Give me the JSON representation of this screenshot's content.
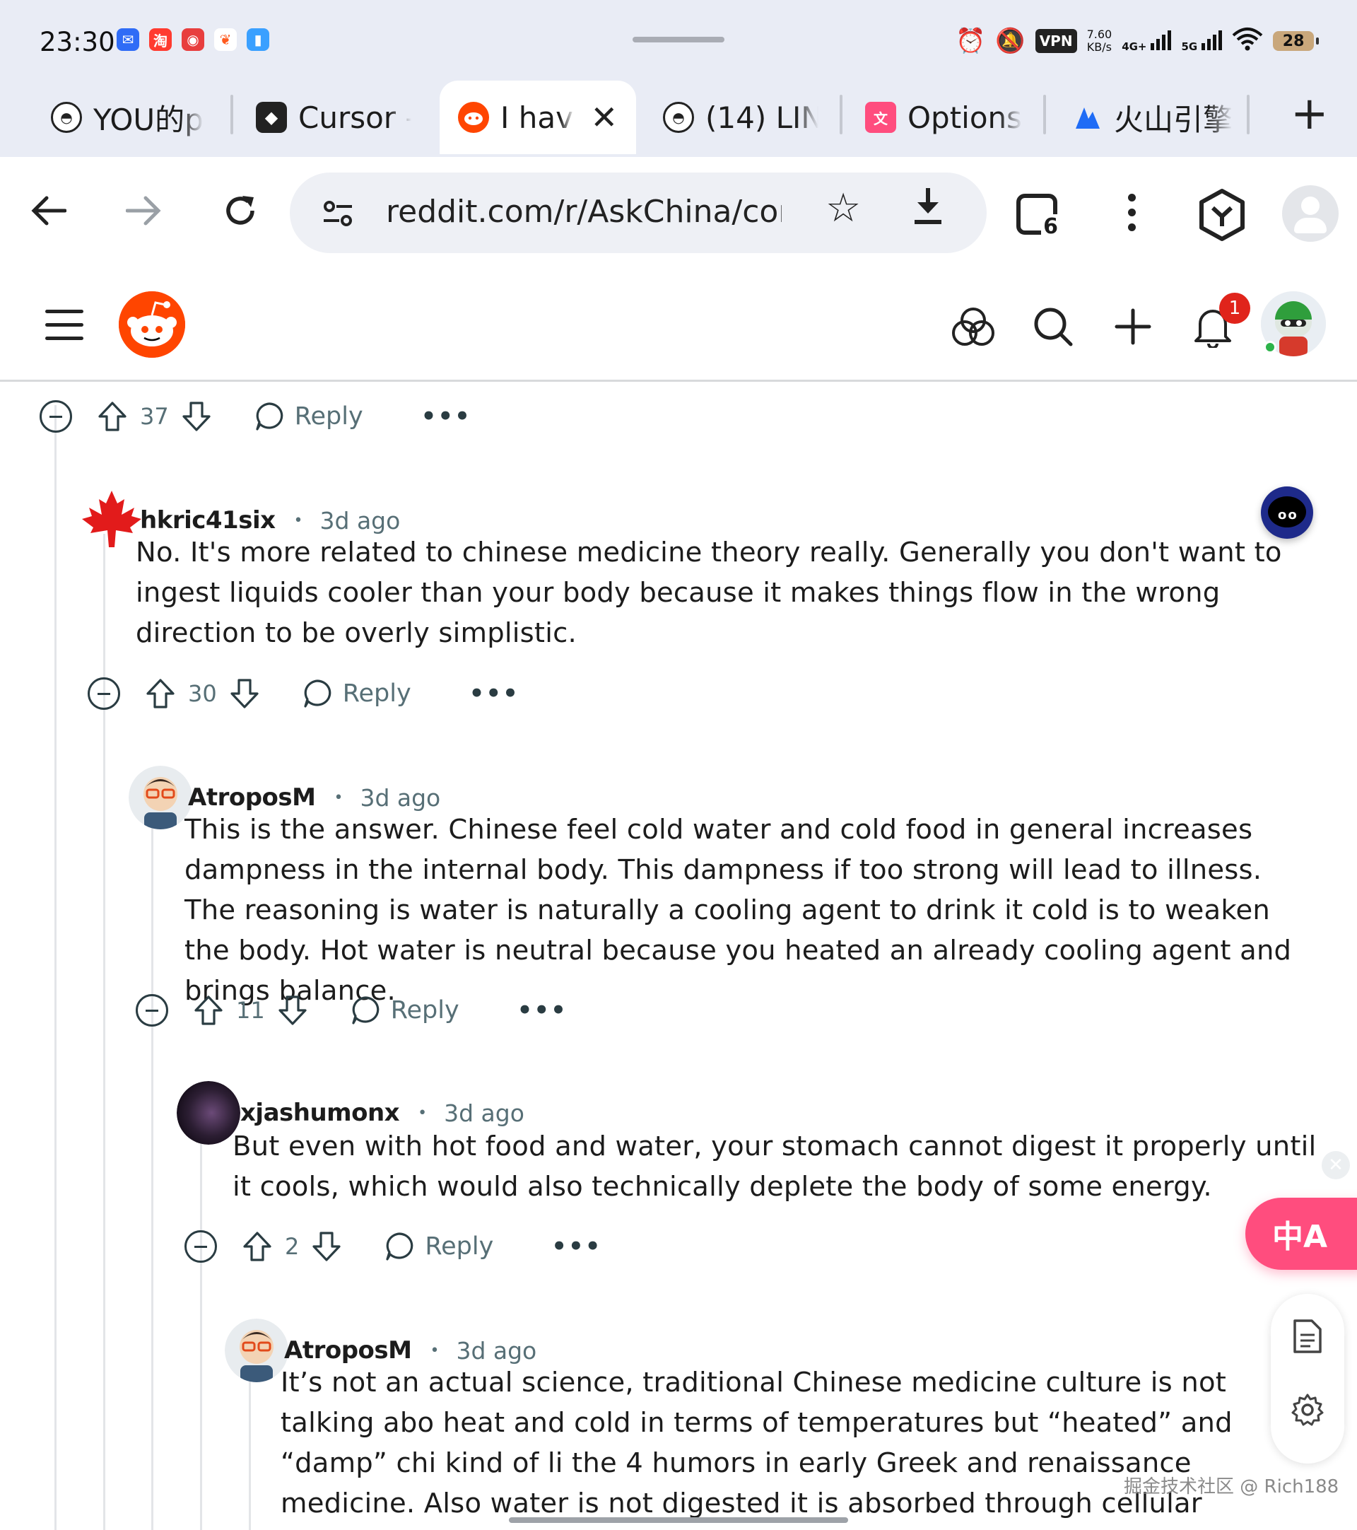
{
  "status_bar": {
    "time": "23:30",
    "app_icons": [
      "mail-app-icon",
      "taobao-app-icon",
      "shopping-app-icon",
      "fruit-app-icon",
      "files-app-icon"
    ],
    "vpn_label": "VPN",
    "speed_value": "7.60",
    "speed_unit": "KB/s",
    "network_4g": "4G+",
    "network_5g": "5G",
    "battery": "28"
  },
  "tabs": [
    {
      "label": "YOU的p",
      "icon": "grad-cap-icon"
    },
    {
      "label": "Cursor -",
      "icon": "cursor-app-icon"
    },
    {
      "label": "I have",
      "icon": "reddit-icon",
      "active": true
    },
    {
      "label": "(14) LIN",
      "icon": "grad-cap-icon"
    },
    {
      "label": "Options",
      "icon": "translate-icon"
    },
    {
      "label": "火山引擎",
      "icon": "volcano-icon"
    }
  ],
  "omnibox": {
    "url": "reddit.com/r/AskChina/comn",
    "tab_count": "6"
  },
  "header": {
    "notification_count": "1"
  },
  "comments": [
    {
      "vote_count": "37",
      "reply_label": "Reply"
    },
    {
      "username": "hkric41six",
      "time": "3d ago",
      "body": "No. It's more related to chinese medicine theory really. Generally you don't want to ingest liquids cooler than your body because it makes things flow in the wrong direction to be overly simplistic.",
      "vote_count": "30",
      "reply_label": "Reply"
    },
    {
      "username": "AtroposM",
      "time": "3d ago",
      "body": "This is the answer. Chinese feel cold water and cold food in general increases dampness in the internal body. This dampness if too strong will lead to illness. The reasoning is water is naturally a cooling agent to drink it cold is to weaken the body. Hot water is neutral because you heated an already cooling agent and brings balance.",
      "vote_count": "11",
      "reply_label": "Reply"
    },
    {
      "username": "xjashumonx",
      "time": "3d ago",
      "body": "But even with hot food and water, your stomach cannot digest it properly until it cools, which would also technically deplete the body of some energy.",
      "vote_count": "2",
      "reply_label": "Reply"
    },
    {
      "username": "AtroposM",
      "time": "3d ago",
      "body": "It’s not an actual science, traditional Chinese medicine culture is not talking abo heat and cold in terms of temperatures but “heated” and “damp” chi kind of li the 4 humors in early Greek and renaissance medicine. Also water is not digested it is absorbed through cellular osmosis."
    }
  ],
  "widgets": {
    "translate_label": "中A",
    "watermark": "掘金技术社区 @ Rich188"
  },
  "colors": {
    "reddit_orange": "#ff4500",
    "chrome_bg": "#e9ecf5",
    "translate_pink": "#ff4d7e",
    "meta_gray": "#576f76"
  }
}
